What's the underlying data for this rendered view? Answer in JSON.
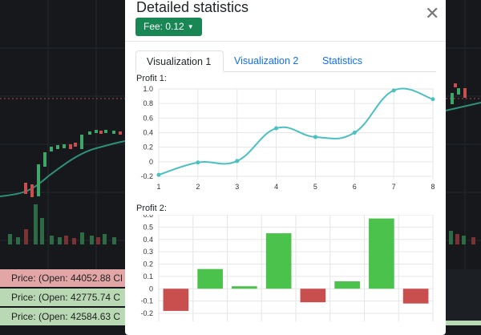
{
  "modal": {
    "title": "Detailed statistics",
    "fee_label": "Fee: 0.12",
    "tabs": [
      "Visualization 1",
      "Visualization 2",
      "Statistics"
    ],
    "active_tab": 0
  },
  "background": {
    "price_rows": [
      "Price: (Open: 44052.88 Cl",
      "Price: (Open: 42775.74 C",
      "Price: (Open: 42584.63 C"
    ]
  },
  "colors": {
    "accent": "#198754",
    "line": "#4bc0c0",
    "positive": "#4bc24b",
    "negative": "#c94f4f",
    "link": "#0d6efd"
  },
  "chart_data": [
    {
      "type": "line",
      "title": "Profit 1:",
      "x": [
        1,
        2,
        3,
        4,
        5,
        6,
        7,
        8
      ],
      "y": [
        -0.18,
        -0.01,
        0.01,
        0.46,
        0.34,
        0.4,
        0.98,
        0.86
      ],
      "xticks": [
        "1",
        "2",
        "3",
        "4",
        "5",
        "6",
        "7",
        "8"
      ],
      "yticks": [
        "1.0",
        "0.8",
        "0.6",
        "0.4",
        "0.2",
        "0",
        "-0.2"
      ],
      "ylim": [
        -0.2,
        1.0
      ],
      "grid": true
    },
    {
      "type": "bar",
      "title": "Profit 2:",
      "values": [
        -0.18,
        0.16,
        0.02,
        0.45,
        -0.11,
        0.06,
        0.57,
        -0.12
      ],
      "yticks": [
        "0.6",
        "0.5",
        "0.4",
        "0.3",
        "0.2",
        "0.1",
        "0",
        "-0.1",
        "-0.2"
      ],
      "ylim": [
        -0.2,
        0.6
      ],
      "grid": true
    }
  ]
}
